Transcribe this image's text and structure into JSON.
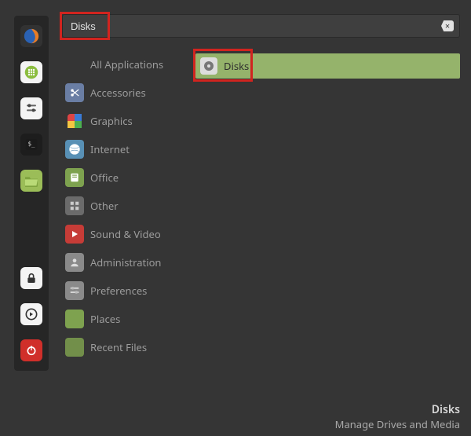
{
  "search": {
    "value": "Disks",
    "clear_glyph": "×"
  },
  "favorites": [
    {
      "name": "firefox",
      "bg": "#323232",
      "svg": "firefox"
    },
    {
      "name": "apps",
      "bg": "#f4f4f4",
      "svg": "grid-green"
    },
    {
      "name": "settings",
      "bg": "#f4f4f4",
      "svg": "sliders"
    },
    {
      "name": "terminal",
      "bg": "#1d1d1d",
      "svg": "terminal"
    },
    {
      "name": "files",
      "bg": "#9bbd58",
      "svg": "folder-open"
    },
    {
      "name": "spacer",
      "spacer": true
    },
    {
      "name": "lock",
      "bg": "#f4f4f4",
      "svg": "lock"
    },
    {
      "name": "logout",
      "bg": "#f4f4f4",
      "svg": "logout"
    },
    {
      "name": "power",
      "bg": "#d02f2a",
      "svg": "power"
    }
  ],
  "categories": [
    {
      "id": "all",
      "label": "All Applications",
      "icon": null
    },
    {
      "id": "accessories",
      "label": "Accessories",
      "icon": "scissors",
      "bg": "#6a7ea4"
    },
    {
      "id": "graphics",
      "label": "Graphics",
      "icon": "palette",
      "bg": "rainbow"
    },
    {
      "id": "internet",
      "label": "Internet",
      "icon": "globe",
      "bg": "#5890b5"
    },
    {
      "id": "office",
      "label": "Office",
      "icon": "office",
      "bg": "#7ea24f"
    },
    {
      "id": "other",
      "label": "Other",
      "icon": "grid",
      "bg": "#6b6b6b"
    },
    {
      "id": "sound-video",
      "label": "Sound & Video",
      "icon": "play",
      "bg": "#c63c37"
    },
    {
      "id": "administration",
      "label": "Administration",
      "icon": "admin",
      "bg": "#8a8a8a"
    },
    {
      "id": "preferences",
      "label": "Preferences",
      "icon": "prefs",
      "bg": "#8a8a8a"
    },
    {
      "id": "places",
      "label": "Places",
      "icon": "folder",
      "bg": "#7ea24f"
    },
    {
      "id": "recent-files",
      "label": "Recent Files",
      "icon": "folder",
      "bg": "#728f4a"
    }
  ],
  "results": [
    {
      "id": "disks",
      "label": "Disks",
      "icon": "disk"
    }
  ],
  "tooltip": {
    "title": "Disks",
    "subtitle": "Manage Drives and Media"
  },
  "colors": {
    "accent": "#95b36b",
    "highlight": "#d1241f"
  }
}
